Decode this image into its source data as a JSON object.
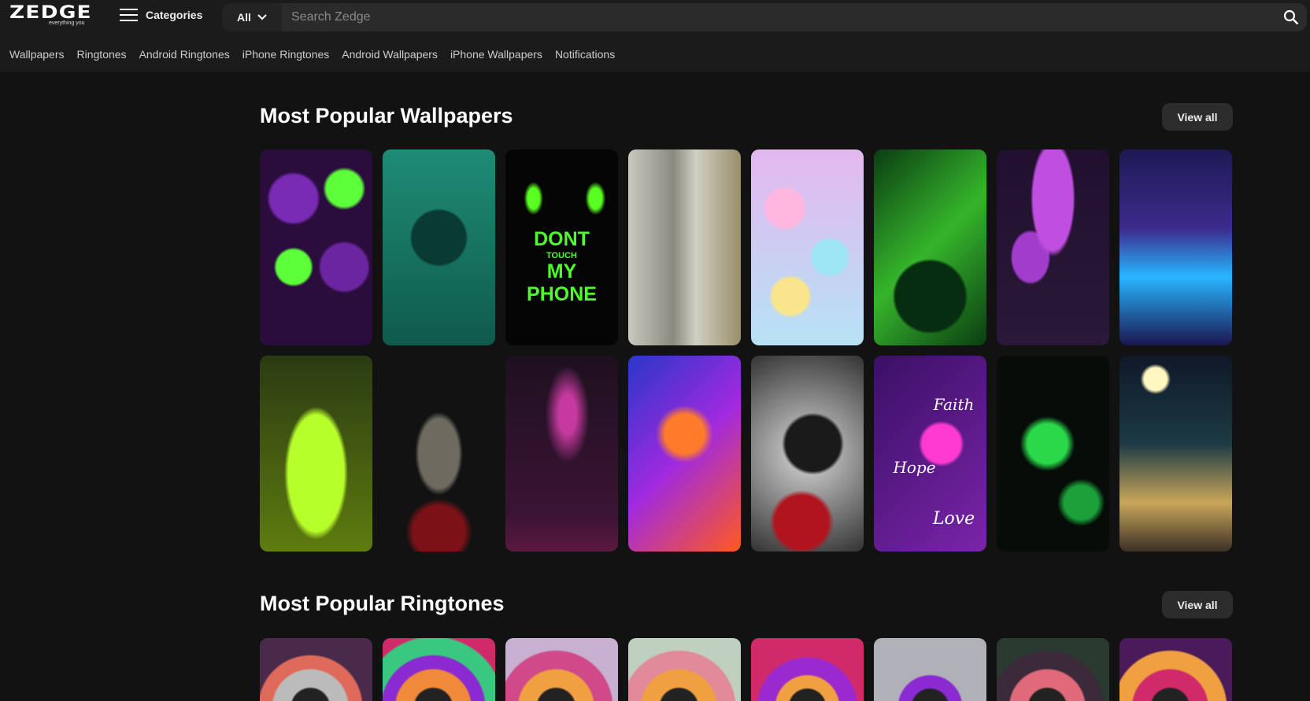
{
  "header": {
    "logo": "ZEDGE",
    "logo_tagline": "everything you",
    "categories_label": "Categories",
    "search_scope": "All",
    "search_placeholder": "Search Zedge"
  },
  "nav": [
    "Wallpapers",
    "Ringtones",
    "Android Ringtones",
    "iPhone Ringtones",
    "Android Wallpapers",
    "iPhone Wallpapers",
    "Notifications"
  ],
  "sections": [
    {
      "title": "Most Popular Wallpapers",
      "view_all": "View all"
    },
    {
      "title": "Most Popular Ringtones",
      "view_all": "View all"
    }
  ],
  "wallpapers": [
    {
      "name": "purple-green-skulls",
      "bg": "radial-gradient(circle at 30% 60%,#5cff3a 0 12%,transparent 14%),radial-gradient(circle at 75% 20%,#5cff3a 0 10%,transparent 12%),radial-gradient(circle at 30% 25%,#7a2bb5 0 14%,transparent 16%),radial-gradient(circle at 75% 60%,#6b25a0 0 16%,transparent 18%),#2a0d3d"
    },
    {
      "name": "four-leaf-clover",
      "bg": "radial-gradient(circle at 50% 45%,#0a3b33 0 22%,transparent 24%),linear-gradient(#1f8c75,#0f5a4c)"
    },
    {
      "name": "dont-touch-my-phone",
      "bg": "radial-gradient(ellipse at 25% 25%,#59ff21 0 5%,transparent 8%),radial-gradient(ellipse at 80% 25%,#59ff21 0 5%,transparent 8%),#050505",
      "text": [
        "DONT",
        "TOUCH",
        "MY",
        "PHONE"
      ]
    },
    {
      "name": "dollar-bill",
      "bg": "linear-gradient(90deg,#c9c9c0,#8a8a80 40%,#d0cfc4 60%,#9a8f6a)"
    },
    {
      "name": "pastel-flowers",
      "bg": "radial-gradient(circle at 30% 30%,#ffb7e0 0 12%,transparent 14%),radial-gradient(circle at 70% 55%,#9ee6f5 0 13%,transparent 15%),radial-gradient(circle at 35% 75%,#f9e58c 0 11%,transparent 13%),linear-gradient(#e4b7f0,#b7e2f4)"
    },
    {
      "name": "pot-of-gold-rainbow",
      "bg": "radial-gradient(circle at 50% 75%,#062d10 0 22%,transparent 24%),linear-gradient(135deg,#0a3d12,#36b52b 50%,#0a3d12)"
    },
    {
      "name": "purple-mushrooms",
      "bg": "radial-gradient(ellipse at 50% 25%,#c04ee0 0 25%,transparent 28%),radial-gradient(ellipse at 30% 55%,#a23ccc 0 16%,transparent 18%),linear-gradient(#21102d,#2a1838)"
    },
    {
      "name": "glowing-waterfall",
      "bg": "linear-gradient(180deg,#1d1a55,#3c2a8a 40%,#28b6ff 65%,#1a1650)"
    },
    {
      "name": "toxic-jar",
      "bg": "radial-gradient(ellipse at 50% 60%,#b7ff2a 0 35%,transparent 40%),linear-gradient(#2b3a12,#5e7c10)"
    },
    {
      "name": "praying-hands",
      "bg": "radial-gradient(ellipse at 50% 50%,#6e6a60 0 25%,transparent 30%),radial-gradient(circle at 50% 90%,#7a1218 0 14%,transparent 18%),#121212"
    },
    {
      "name": "pink-rose-night",
      "bg": "radial-gradient(ellipse at 55% 30%,#c63aa0 0 10%,transparent 25%),linear-gradient(#1e1020,#3a1434 80%,#5a1840)"
    },
    {
      "name": "fire-skull-hoodie",
      "bg": "radial-gradient(circle at 50% 40%,#ff7b2a 0 15%,transparent 22%),linear-gradient(135deg,#2a36c8,#a02ae0 50%,#ff5a1e)"
    },
    {
      "name": "butterfly-rose",
      "bg": "radial-gradient(circle at 45% 85%,#b0141e 0 15%,transparent 18%),radial-gradient(circle at 55% 45%,#1a1a1a 0 22%,transparent 25%),radial-gradient(circle at 50% 50%,#d9d9d9,#333)"
    },
    {
      "name": "faith-hope-love",
      "bg": "radial-gradient(circle at 60% 45%,#ff3ad0 0 15%,transparent 18%),linear-gradient(135deg,#3a1066,#7a24a8)",
      "text": [
        "Faith",
        "Hope",
        "Love"
      ]
    },
    {
      "name": "green-flower",
      "bg": "radial-gradient(circle at 45% 45%,#2ad84a 0 16%,transparent 22%),radial-gradient(circle at 75% 75%,#1ca03a 0 10%,transparent 14%),#060d08"
    },
    {
      "name": "moonlit-beach",
      "bg": "radial-gradient(circle at 32% 12%,#fff6c0 0 6%,transparent 8%),linear-gradient(#101828,#1c3a44 45%,#c9a65a 75%,#3a3024)"
    }
  ],
  "ringtones": [
    {
      "name": "ringtone-1",
      "bg": "radial-gradient(circle at 45% 110%,#222 0 20%,#bbb 22% 40%,#e06a5a 42% 55%,#4a2a4a 57%)"
    },
    {
      "name": "ringtone-2",
      "bg": "radial-gradient(circle at 45% 110%,#222 0 20%,#f08a3a 22% 40%,#8a2ad0 42% 55%,#3ac880 57% 75%,#d02a6a 77%)"
    },
    {
      "name": "ringtone-3",
      "bg": "radial-gradient(circle at 45% 110%,#222 0 20%,#f0a040 22% 40%,#d04a8a 42% 60%,#c8b0d0 62%)"
    },
    {
      "name": "ringtone-4",
      "bg": "radial-gradient(circle at 45% 110%,#222 0 20%,#f0a040 22% 40%,#e08a9a 42% 60%,#c0d0c0 62%)"
    },
    {
      "name": "ringtone-5",
      "bg": "radial-gradient(circle at 50% 110%,#222 0 20%,#f0a040 22% 35%,#9a2ad0 37% 55%,#d02a6a 57%)"
    },
    {
      "name": "ringtone-6",
      "bg": "radial-gradient(circle at 50% 110%,#222 0 20%,#8a2ad0 22% 35%,#b0b0b8 37%)"
    },
    {
      "name": "ringtone-7",
      "bg": "radial-gradient(circle at 45% 110%,#222 0 20%,#e06a7a 22% 40%,#3a2a3a 42% 60%,#2a3a30 62%)"
    },
    {
      "name": "ringtone-8",
      "bg": "radial-gradient(circle at 45% 110%,#222 0 20%,#d02a6a 22% 40%,#f0a040 42% 60%,#4a1a5a 62%)"
    }
  ]
}
